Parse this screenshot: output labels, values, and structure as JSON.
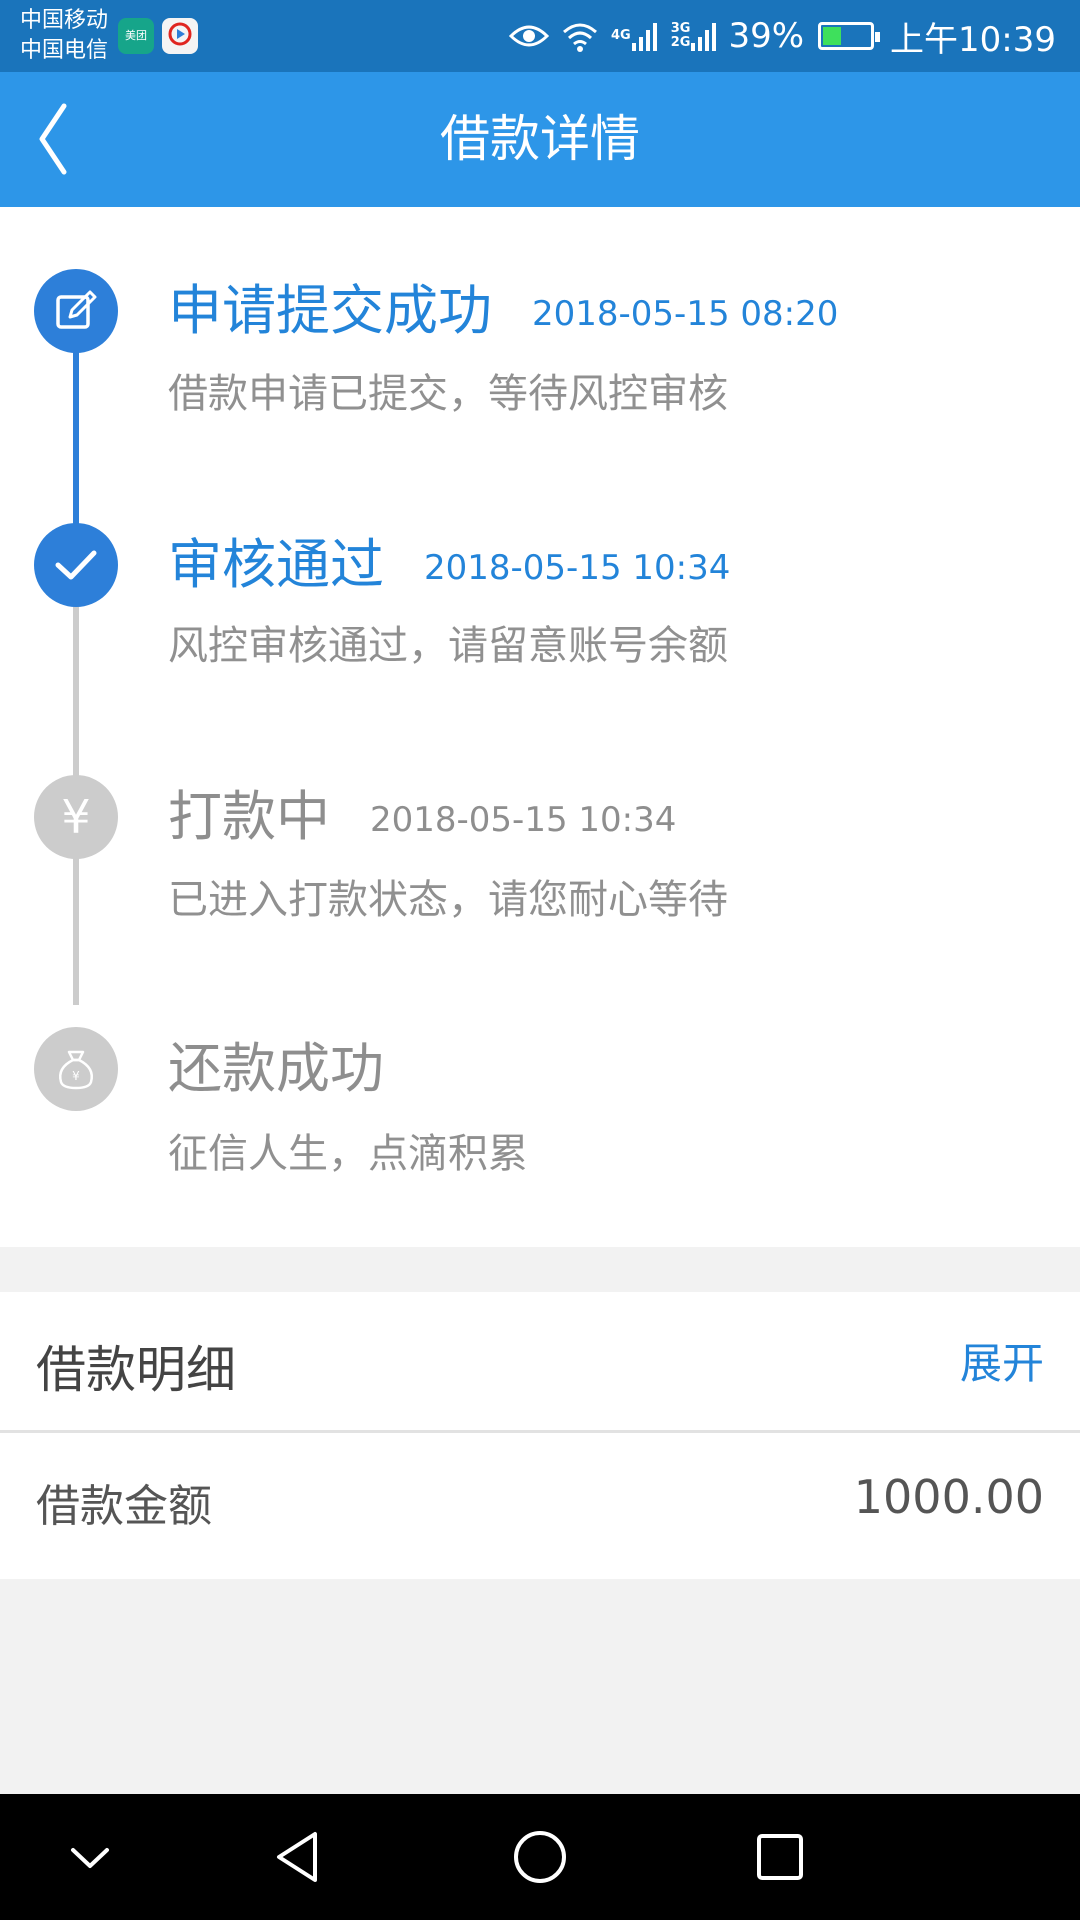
{
  "status_bar": {
    "carrier_1": "中国移动",
    "carrier_2": "中国电信",
    "app_badge_1": "美团",
    "app_badge_2": "",
    "network_1": "4G",
    "network_2a": "3G",
    "network_2b": "2G",
    "battery": "39%",
    "battery_level": 0.39,
    "time": "上午10:39"
  },
  "nav": {
    "title": "借款详情"
  },
  "timeline": [
    {
      "title": "申请提交成功",
      "time": "2018-05-15 08:20",
      "desc": "借款申请已提交，等待风控审核",
      "icon": "edit-icon",
      "done": true
    },
    {
      "title": "审核通过",
      "time": "2018-05-15 10:34",
      "desc": "风控审核通过，请留意账号余额",
      "icon": "check-icon",
      "done": true
    },
    {
      "title": "打款中",
      "time": "2018-05-15 10:34",
      "desc": "已进入打款状态，请您耐心等待",
      "icon": "yen-icon",
      "done": false
    },
    {
      "title": "还款成功",
      "time": "",
      "desc": "征信人生，点滴积累",
      "icon": "money-bag-icon",
      "done": false
    }
  ],
  "detail": {
    "title": "借款明细",
    "expand": "展开",
    "amount_label": "借款金额",
    "amount_value": "1000.00"
  },
  "colors": {
    "primary": "#2d96e8",
    "status_bar": "#1a74bb",
    "accent_text": "#2384d9",
    "inactive": "#cccccc"
  }
}
